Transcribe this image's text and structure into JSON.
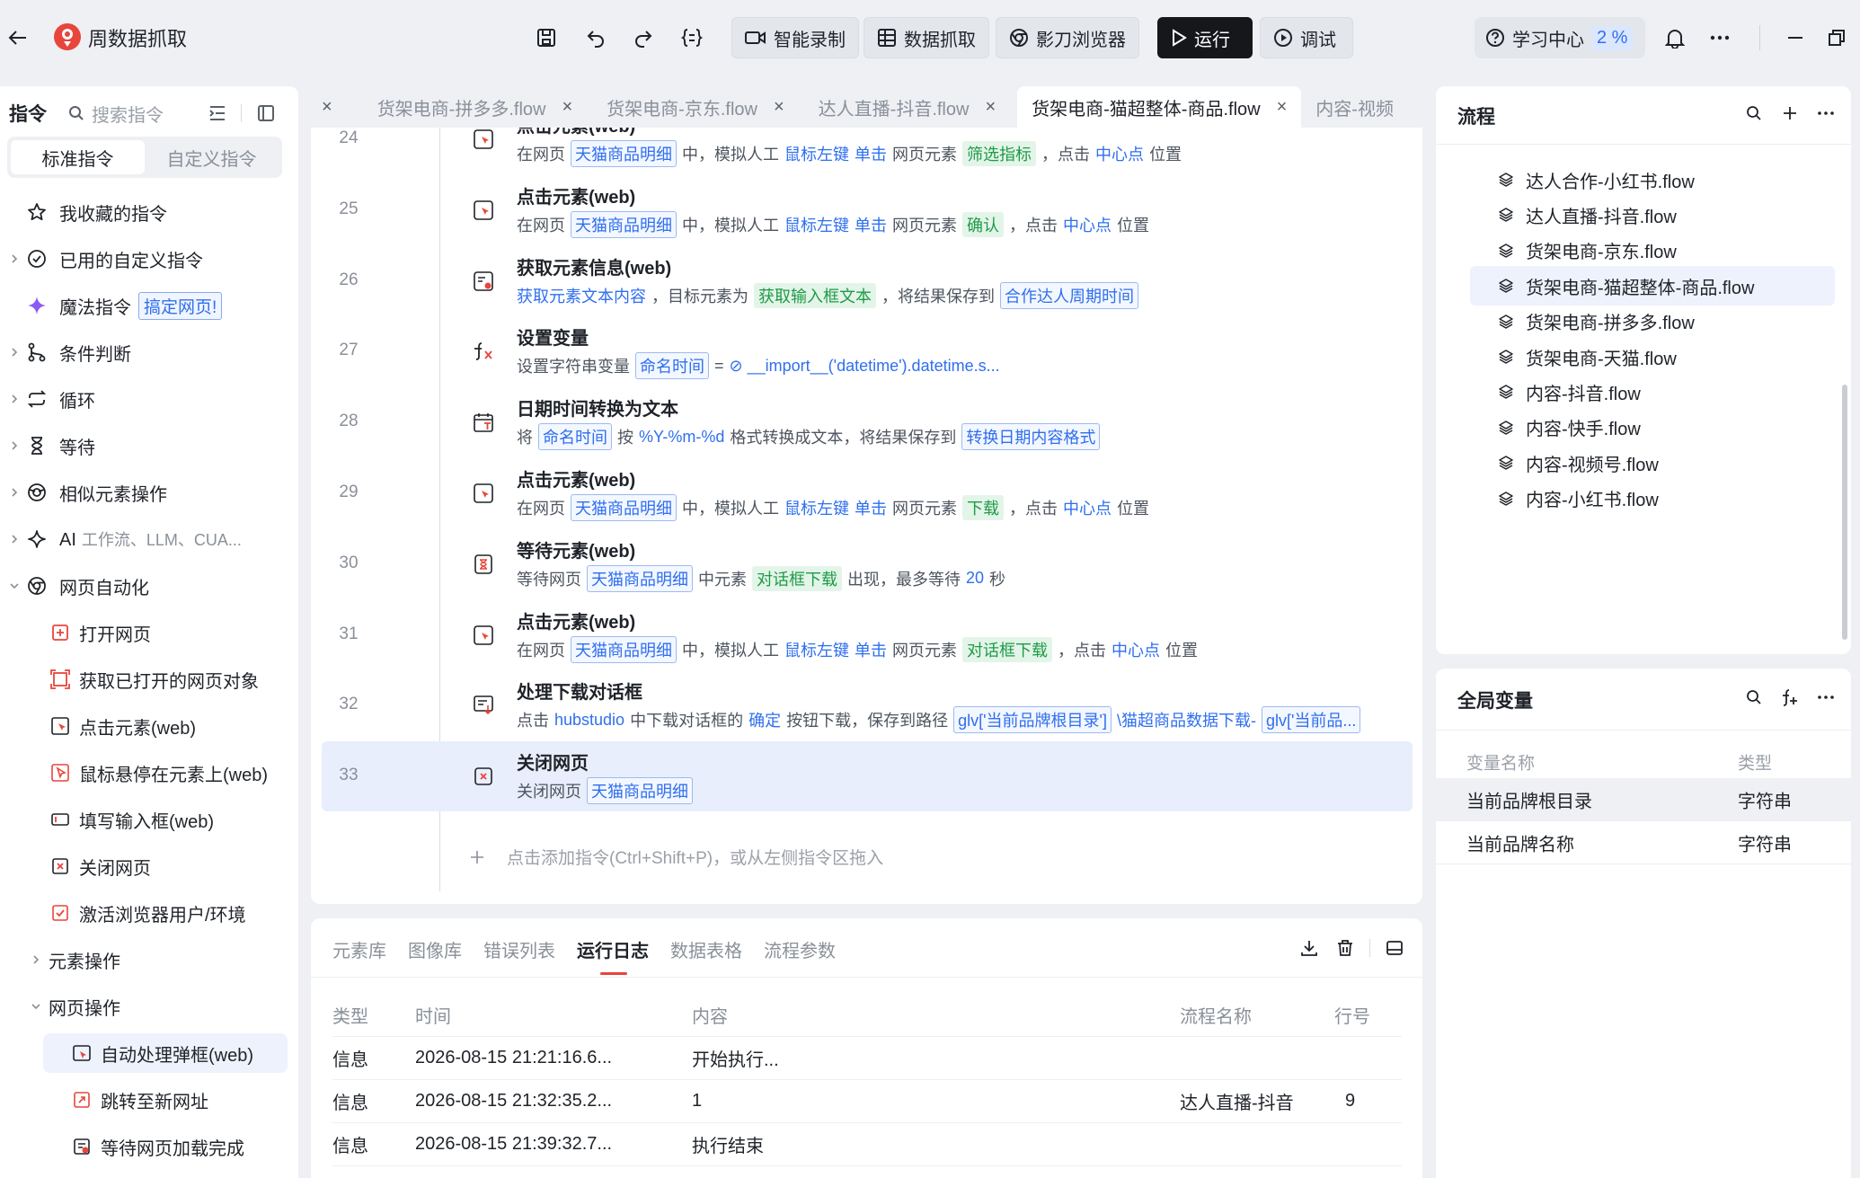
{
  "app": {
    "title": "周数据抓取",
    "buttons": {
      "smart_record": "智能录制",
      "data_capture": "数据抓取",
      "browser": "影刀浏览器",
      "run": "运行",
      "debug": "调试"
    },
    "learn_center": "学习中心",
    "learn_pct": "2 %"
  },
  "sidebar": {
    "header": "指令",
    "search_placeholder": "搜索指令",
    "tabs": [
      "标准指令",
      "自定义指令"
    ],
    "items": [
      {
        "label": "我收藏的指令",
        "icon": "star-icon"
      },
      {
        "label": "已用的自定义指令",
        "icon": "check-circle-icon"
      },
      {
        "label": "魔法指令",
        "icon": "sparkle-icon",
        "tag": "搞定网页!"
      },
      {
        "label": "条件判断",
        "icon": "branch-icon"
      },
      {
        "label": "循环",
        "icon": "loop-icon"
      },
      {
        "label": "等待",
        "icon": "hourglass-icon"
      },
      {
        "label": "相似元素操作",
        "icon": "similar-icon"
      },
      {
        "label": "AI",
        "sub": "工作流、LLM、CUA...",
        "icon": "ai-icon"
      },
      {
        "label": "网页自动化",
        "icon": "chrome-icon"
      }
    ],
    "web_items": [
      "打开网页",
      "获取已打开的网页对象",
      "点击元素(web)",
      "鼠标悬停在元素上(web)",
      "填写输入框(web)",
      "关闭网页",
      "激活浏览器用户/环境"
    ],
    "groups": [
      "元素操作",
      "网页操作"
    ],
    "page_items": [
      "自动处理弹框(web)",
      "跳转至新网址",
      "等待网页加载完成"
    ]
  },
  "tabs": [
    {
      "label": "货架电商-拼多多.flow",
      "active": false
    },
    {
      "label": "货架电商-京东.flow",
      "active": false
    },
    {
      "label": "达人直播-抖音.flow",
      "active": false
    },
    {
      "label": "货架电商-猫超整体-商品.flow",
      "active": true
    },
    {
      "label": "内容-视频",
      "active": false
    }
  ],
  "editor": {
    "rows": [
      {
        "ln": "24",
        "title": "点击元素(web)",
        "parts": [
          [
            "t",
            "在网页"
          ],
          [
            "b",
            "天猫商品明细"
          ],
          [
            "t",
            "中，模拟人工"
          ],
          [
            "l",
            "鼠标左键"
          ],
          [
            "l",
            "单击"
          ],
          [
            "t",
            "网页元素"
          ],
          [
            "g",
            "筛选指标"
          ],
          [
            "t",
            "，点击"
          ],
          [
            "l",
            "中心点"
          ],
          [
            "t",
            "位置"
          ]
        ]
      },
      {
        "ln": "25",
        "title": "点击元素(web)",
        "parts": [
          [
            "t",
            "在网页"
          ],
          [
            "b",
            "天猫商品明细"
          ],
          [
            "t",
            "中，模拟人工"
          ],
          [
            "l",
            "鼠标左键"
          ],
          [
            "l",
            "单击"
          ],
          [
            "t",
            "网页元素"
          ],
          [
            "g",
            "确认"
          ],
          [
            "t",
            "，点击"
          ],
          [
            "l",
            "中心点"
          ],
          [
            "t",
            "位置"
          ]
        ]
      },
      {
        "ln": "26",
        "title": "获取元素信息(web)",
        "parts": [
          [
            "l",
            "获取元素文本内容"
          ],
          [
            "t",
            "，目标元素为"
          ],
          [
            "g",
            "获取输入框文本"
          ],
          [
            "t",
            "，将结果保存到"
          ],
          [
            "b",
            "合作达人周期时间"
          ]
        ]
      },
      {
        "ln": "27",
        "title": "设置变量",
        "parts": [
          [
            "t",
            "设置字符串变量"
          ],
          [
            "b",
            "命名时间"
          ],
          [
            "t",
            "="
          ],
          [
            "l",
            "⊘ __import__('datetime').datetime.s..."
          ]
        ]
      },
      {
        "ln": "28",
        "title": "日期时间转换为文本",
        "parts": [
          [
            "t",
            "将"
          ],
          [
            "b",
            "命名时间"
          ],
          [
            "t",
            "按"
          ],
          [
            "l",
            "%Y-%m-%d"
          ],
          [
            "t",
            "格式转换成文本，将结果保存到"
          ],
          [
            "b",
            "转换日期内容格式"
          ]
        ]
      },
      {
        "ln": "29",
        "title": "点击元素(web)",
        "parts": [
          [
            "t",
            "在网页"
          ],
          [
            "b",
            "天猫商品明细"
          ],
          [
            "t",
            "中，模拟人工"
          ],
          [
            "l",
            "鼠标左键"
          ],
          [
            "l",
            "单击"
          ],
          [
            "t",
            "网页元素"
          ],
          [
            "g",
            "下载"
          ],
          [
            "t",
            "，点击"
          ],
          [
            "l",
            "中心点"
          ],
          [
            "t",
            "位置"
          ]
        ]
      },
      {
        "ln": "30",
        "title": "等待元素(web)",
        "parts": [
          [
            "t",
            "等待网页"
          ],
          [
            "b",
            "天猫商品明细"
          ],
          [
            "t",
            "中元素"
          ],
          [
            "g",
            "对话框下载"
          ],
          [
            "t",
            "出现，最多等待"
          ],
          [
            "l",
            "20"
          ],
          [
            "t",
            "秒"
          ]
        ]
      },
      {
        "ln": "31",
        "title": "点击元素(web)",
        "parts": [
          [
            "t",
            "在网页"
          ],
          [
            "b",
            "天猫商品明细"
          ],
          [
            "t",
            "中，模拟人工"
          ],
          [
            "l",
            "鼠标左键"
          ],
          [
            "l",
            "单击"
          ],
          [
            "t",
            "网页元素"
          ],
          [
            "g",
            "对话框下载"
          ],
          [
            "t",
            "，点击"
          ],
          [
            "l",
            "中心点"
          ],
          [
            "t",
            "位置"
          ]
        ]
      },
      {
        "ln": "32",
        "title": "处理下载对话框",
        "parts": [
          [
            "t",
            "点击"
          ],
          [
            "l",
            "hubstudio"
          ],
          [
            "t",
            "中下载对话框的"
          ],
          [
            "l",
            "确定"
          ],
          [
            "t",
            "按钮下载，保存到路径"
          ],
          [
            "b",
            "glv['当前品牌根目录']"
          ],
          [
            "l",
            "\\猫超商品数据下载-"
          ],
          [
            "b",
            "glv['当前品..."
          ]
        ]
      },
      {
        "ln": "33",
        "title": "关闭网页",
        "parts": [
          [
            "t",
            "关闭网页"
          ],
          [
            "b",
            "天猫商品明细"
          ]
        ]
      }
    ],
    "add_hint": "点击添加指令(Ctrl+Shift+P)，或从左侧指令区拖入"
  },
  "bottom": {
    "tabs": [
      "元素库",
      "图像库",
      "错误列表",
      "运行日志",
      "数据表格",
      "流程参数"
    ],
    "active_tab": "运行日志",
    "columns": [
      "类型",
      "时间",
      "内容",
      "流程名称",
      "行号"
    ],
    "logs": [
      {
        "type": "信息",
        "time": "2026-08-15 21:21:16.6...",
        "content": "开始执行...",
        "flow": "",
        "line": ""
      },
      {
        "type": "信息",
        "time": "2026-08-15 21:32:35.2...",
        "content": "1",
        "flow": "达人直播-抖音",
        "line": "9"
      },
      {
        "type": "信息",
        "time": "2026-08-15 21:39:32.7...",
        "content": "执行结束",
        "flow": "",
        "line": ""
      }
    ]
  },
  "flows": {
    "title": "流程",
    "items": [
      "达人合作-小红书.flow",
      "达人直播-抖音.flow",
      "货架电商-京东.flow",
      "货架电商-猫超整体-商品.flow",
      "货架电商-拼多多.flow",
      "货架电商-天猫.flow",
      "内容-抖音.flow",
      "内容-快手.flow",
      "内容-视频号.flow",
      "内容-小红书.flow"
    ],
    "active_index": 3
  },
  "vars": {
    "title": "全局变量",
    "columns": [
      "变量名称",
      "类型"
    ],
    "rows": [
      {
        "name": "当前品牌根目录",
        "type": "字符串"
      },
      {
        "name": "当前品牌名称",
        "type": "字符串"
      }
    ]
  }
}
